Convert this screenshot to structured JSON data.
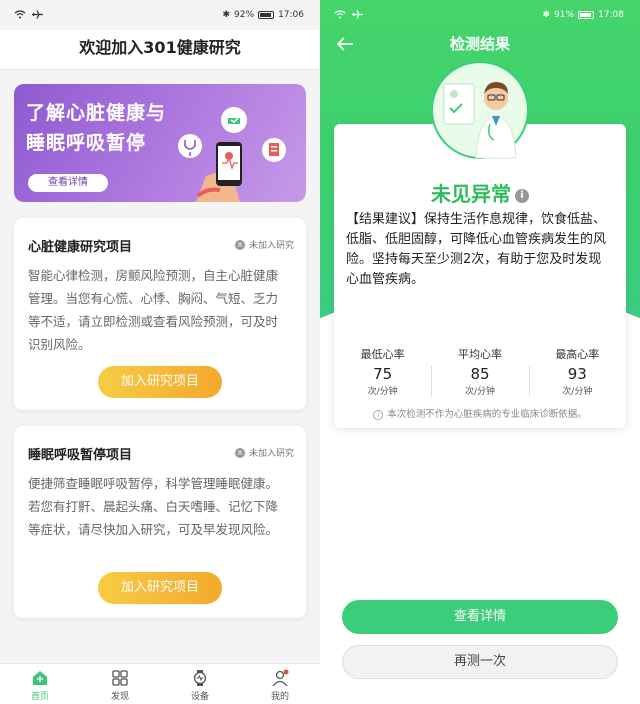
{
  "left": {
    "status": {
      "time": "17:06",
      "battery": "92%"
    },
    "header_title": "欢迎加入301健康研究",
    "banner": {
      "line1": "了解心脏健康与",
      "line2": "睡眠呼吸暂停",
      "button": "查看详情"
    },
    "cards": [
      {
        "title": "心脏健康研究项目",
        "badge": "未加入研究",
        "desc": "智能心律检测，房颤风险预测，自主心脏健康管理。当您有心慌、心悸、胸闷、气短、乏力等不适，请立即检测或查看风险预测，可及时识别风险。",
        "button": "加入研究项目"
      },
      {
        "title": "睡眠呼吸暂停项目",
        "badge": "未加入研究",
        "desc": "便捷筛查睡眠呼吸暂停，科学管理睡眠健康。若您有打鼾、晨起头痛、白天嗜睡、记忆下降等症状，请尽快加入研究，可及早发现风险。",
        "button": "加入研究项目"
      }
    ],
    "tabs": [
      {
        "label": "首页",
        "icon": "home-icon"
      },
      {
        "label": "发现",
        "icon": "grid-icon"
      },
      {
        "label": "设备",
        "icon": "watch-icon"
      },
      {
        "label": "我的",
        "icon": "profile-icon"
      }
    ]
  },
  "right": {
    "status": {
      "time": "17:08",
      "battery": "91%"
    },
    "header_title": "检测结果",
    "result_title": "未见异常",
    "advice": "【结果建议】保持生活作息规律，饮食低盐、低脂、低胆固醇，可降低心血管疾病发生的风险。坚持每天至少测2次，有助于您及时发现心血管疾病。",
    "rates": [
      {
        "label": "最低心率",
        "value": "75",
        "unit": "次/分钟"
      },
      {
        "label": "平均心率",
        "value": "85",
        "unit": "次/分钟"
      },
      {
        "label": "最高心率",
        "value": "93",
        "unit": "次/分钟"
      }
    ],
    "disclaimer": "本次检测不作为心脏疾病的专业临床诊断依据。",
    "btn_detail": "查看详情",
    "btn_again": "再测一次"
  },
  "colors": {
    "accent_green": "#3ccd7a",
    "banner_purple": "#8e5ad1",
    "join_orange": "#f4a92c"
  }
}
